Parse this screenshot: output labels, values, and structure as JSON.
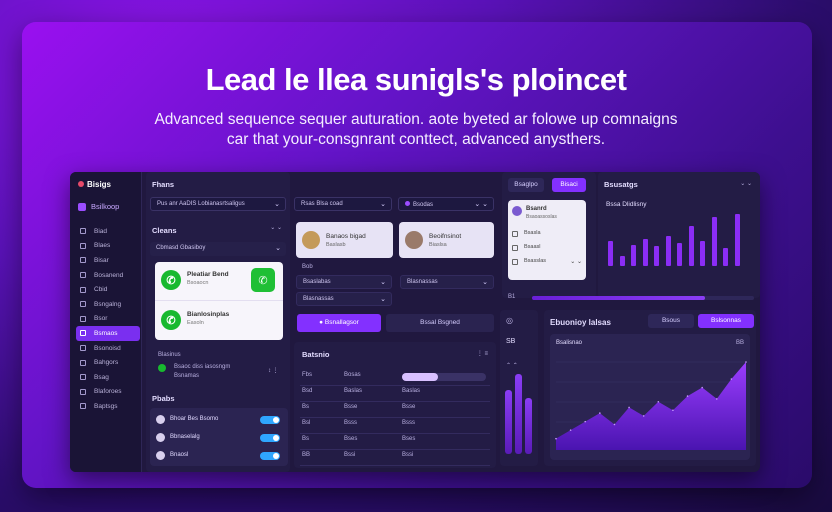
{
  "hero": {
    "headline": "Lead le llea sunigls's ploincet",
    "subline_1": "Advanced sequence sequer auturation. aote byeted ar folowe up comnaigns",
    "subline_2": "car that your-consgnrant conttect, advanced anysthers."
  },
  "sidebar": {
    "brand": "Bisigs",
    "profile": "Bsilkoop",
    "items": [
      {
        "label": "Biad",
        "active": false
      },
      {
        "label": "Blaes",
        "active": false
      },
      {
        "label": "Bisar",
        "active": false
      },
      {
        "label": "Bosanend",
        "active": false
      },
      {
        "label": "Cbid",
        "active": false
      },
      {
        "label": "Bsngalng",
        "active": false
      },
      {
        "label": "Bsor",
        "active": false
      },
      {
        "label": "Bsmaos",
        "active": true
      },
      {
        "label": "Bsonoisd",
        "active": false
      },
      {
        "label": "Bahgors",
        "active": false
      },
      {
        "label": "Bsag",
        "active": false
      },
      {
        "label": "Blaforoes",
        "active": false
      },
      {
        "label": "Baptsgs",
        "active": false
      }
    ]
  },
  "contacts_col": {
    "title": "Fhans",
    "filter": "Pus anr AaDIS Lobianasrtsaligus",
    "section": "Cleans",
    "sub_filter": "Cbmasd Gbasiboy",
    "card_item_1_title": "Pleatiar Bend",
    "card_item_1_sub": "Bsoaocn",
    "card_item_2_title": "Bianlosinplas",
    "card_item_2_sub": "Easoln",
    "footer_label": "Blasinus",
    "footer_item": "Bsaoc diss iasosngm",
    "footer_item_2": "Bsnamas",
    "tasks_title": "Pbabs",
    "tasks": [
      {
        "label": "Bhoar Bes Bsomo"
      },
      {
        "label": "Bbnaselalg"
      },
      {
        "label": "Bnaosl"
      }
    ]
  },
  "middle_col": {
    "filter_1": "Rsas Blsa coad",
    "filter_2": "Bsodas",
    "profile_1_name": "Banaos bigad",
    "profile_1_sub": "Baslasb",
    "profile_2_name": "Beoifnsinot",
    "profile_2_sub": "Biaslsa",
    "row_1": "Bob",
    "row_2": "Bsaslabas",
    "row_3": "Blasnassas",
    "btn_primary": "Bsnallagsor",
    "btn_secondary": "Bssal Bsgned",
    "table_title": "Batsnio",
    "table_rows": [
      {
        "c1": "Fbs",
        "c2": "Bosas"
      },
      {
        "c1": "Bsd",
        "c2": "Baslas"
      },
      {
        "c1": "Bs",
        "c2": "Bsse"
      },
      {
        "c1": "Bsl",
        "c2": "Bsss"
      },
      {
        "c1": "Bs",
        "c2": "Bses"
      },
      {
        "c1": "BB",
        "c2": "Bssi"
      }
    ]
  },
  "right_col": {
    "tab_1": "Bsaglpo",
    "tab_2": "Bisaci",
    "tab_3": "Bsusatgs",
    "card_name": "Bsanrd",
    "card_sub": "Bsaoassoslas",
    "card_rows": [
      "Bsasla",
      "Bsaasl",
      "Bsasslas"
    ],
    "chart_label": "Bssa Dlidlisny",
    "progress": 0.78,
    "progress_label": "B1",
    "side_label": "SB",
    "bottom_title": "Ebuonioy lalsas",
    "bottom_btn_1": "Bsous",
    "bottom_btn_2": "Bslsonnas",
    "area_title": "Bsalisnao",
    "area_right": "BB"
  },
  "colors": {
    "accent": "#8330ff",
    "whatsapp": "#18b92f",
    "toggle": "#2fa6ff"
  },
  "chart_data": [
    {
      "type": "bar",
      "values": [
        30,
        12,
        25,
        32,
        24,
        36,
        28,
        48,
        30,
        58,
        22,
        62
      ]
    },
    {
      "type": "area",
      "values": [
        8,
        14,
        20,
        26,
        18,
        30,
        24,
        34,
        28,
        38,
        44,
        36,
        50,
        62
      ]
    }
  ]
}
